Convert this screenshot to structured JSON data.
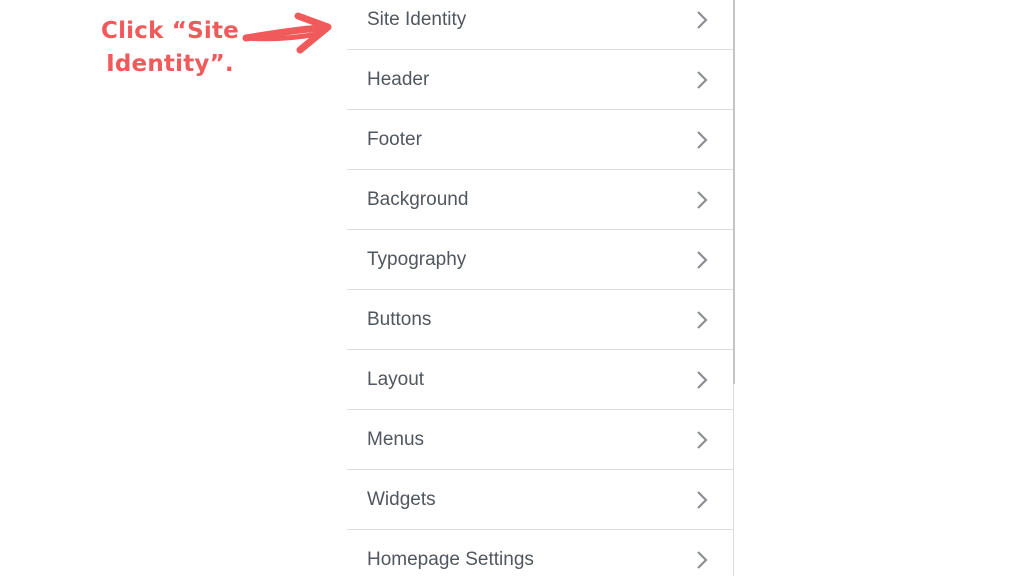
{
  "annotation": {
    "line1": "Click “Site",
    "line2": "Identity”.",
    "color": "#f05a5a"
  },
  "panel": {
    "items": [
      {
        "label": "Site Identity",
        "icon": "chevron-right-icon"
      },
      {
        "label": "Header",
        "icon": "chevron-right-icon"
      },
      {
        "label": "Footer",
        "icon": "chevron-right-icon"
      },
      {
        "label": "Background",
        "icon": "chevron-right-icon"
      },
      {
        "label": "Typography",
        "icon": "chevron-right-icon"
      },
      {
        "label": "Buttons",
        "icon": "chevron-right-icon"
      },
      {
        "label": "Layout",
        "icon": "chevron-right-icon"
      },
      {
        "label": "Menus",
        "icon": "chevron-right-icon"
      },
      {
        "label": "Widgets",
        "icon": "chevron-right-icon"
      },
      {
        "label": "Homepage Settings",
        "icon": "chevron-right-icon"
      }
    ],
    "text_color": "#50575e",
    "divider_color": "#dcdcde"
  }
}
